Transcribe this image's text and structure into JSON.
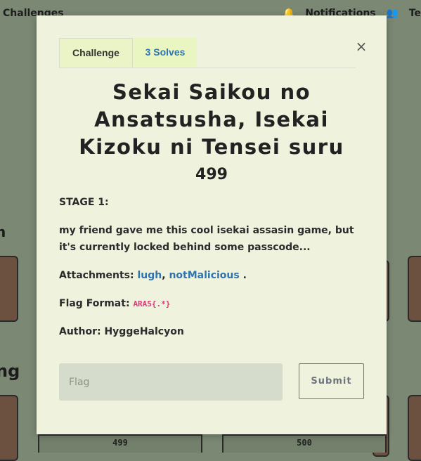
{
  "background": {
    "nav_left": "Challenges",
    "notifications": "Notifications",
    "team": "Te",
    "heading1": "n",
    "heading2": "ng",
    "card_scores": [
      "499",
      "500"
    ]
  },
  "modal": {
    "tabs": [
      {
        "label": "Challenge"
      },
      {
        "label": "3 Solves"
      }
    ],
    "close_label": "×",
    "title": "Sekai Saikou no Ansatsusha, Isekai Kizoku ni Tensei suru",
    "value": "499",
    "stage": "STAGE 1:",
    "description": "my friend gave me this cool isekai assasin game, but it's currently locked behind some passcode...",
    "attachments_label": "Attachments:",
    "attachments": [
      "lugh",
      "notMalicious"
    ],
    "attachments_sep": ",",
    "attachments_end": ".",
    "flag_format_label": "Flag Format:",
    "flag_format": "ARA5{.*}",
    "author": "Author: HyggeHalcyon",
    "flag_placeholder": "Flag",
    "submit_label": "Submit"
  }
}
